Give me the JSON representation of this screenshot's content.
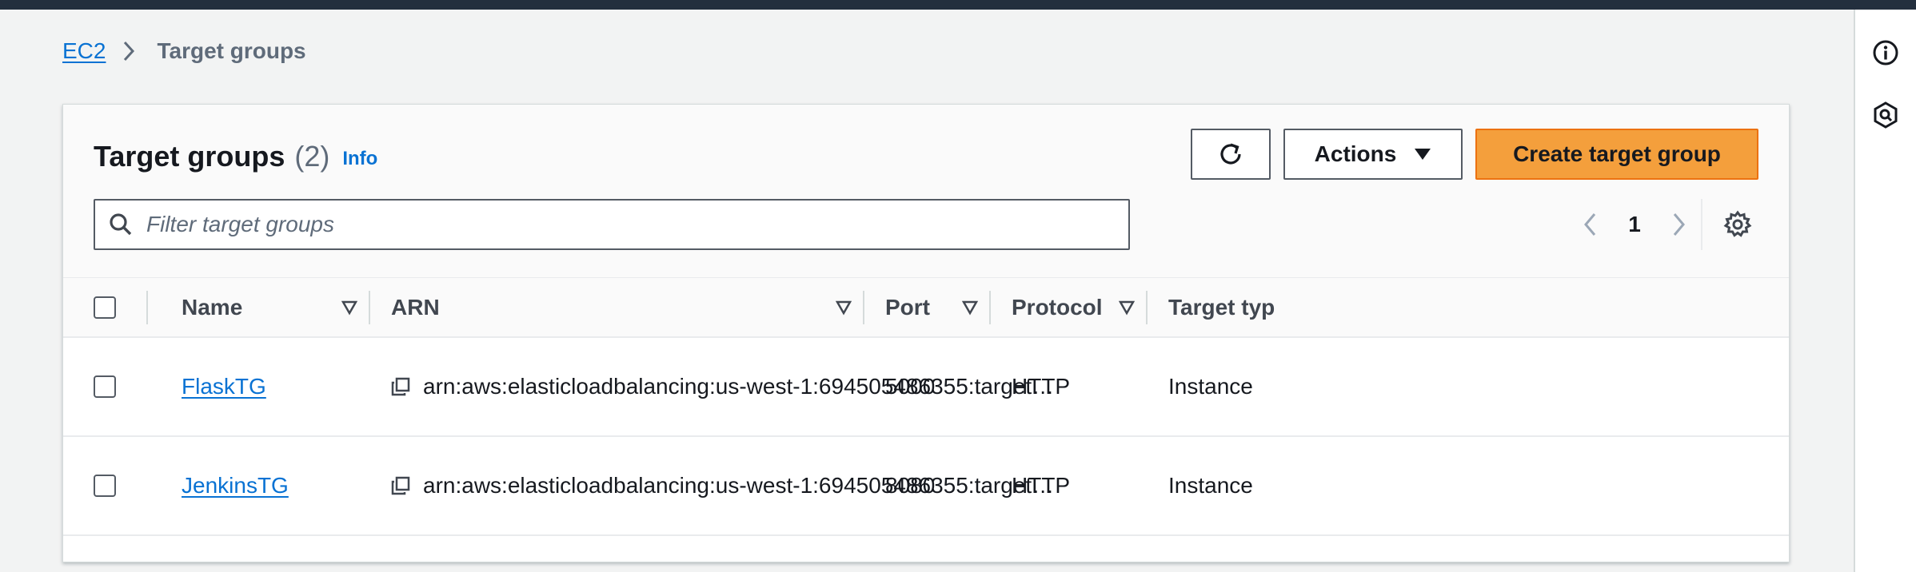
{
  "breadcrumb": {
    "root": "EC2",
    "current": "Target groups"
  },
  "panel": {
    "title": "Target groups",
    "count": "(2)",
    "info_label": "Info",
    "actions_label": "Actions",
    "create_label": "Create target group",
    "search_placeholder": "Filter target groups",
    "page": "1"
  },
  "table": {
    "columns": [
      "Name",
      "ARN",
      "Port",
      "Protocol",
      "Target typ"
    ],
    "rows": [
      {
        "name": "FlaskTG",
        "arn": "arn:aws:elasticloadbalancing:us-west-1:694505486355:target…",
        "port": "5000",
        "protocol": "HTTP",
        "target_type": "Instance"
      },
      {
        "name": "JenkinsTG",
        "arn": "arn:aws:elasticloadbalancing:us-west-1:694505486355:target…",
        "port": "8080",
        "protocol": "HTTP",
        "target_type": "Instance"
      }
    ]
  },
  "icons": {
    "rail": [
      "info-icon",
      "security-hex-icon"
    ],
    "toolbar": [
      "refresh-icon",
      "caret-down-icon",
      "search-icon",
      "chevron-left-icon",
      "chevron-right-icon",
      "settings-gear-icon",
      "copy-icon",
      "sort-icon"
    ]
  },
  "colors": {
    "primary_button": "#f49f3c",
    "link": "#0972d3",
    "top_bar": "#232f3e"
  }
}
